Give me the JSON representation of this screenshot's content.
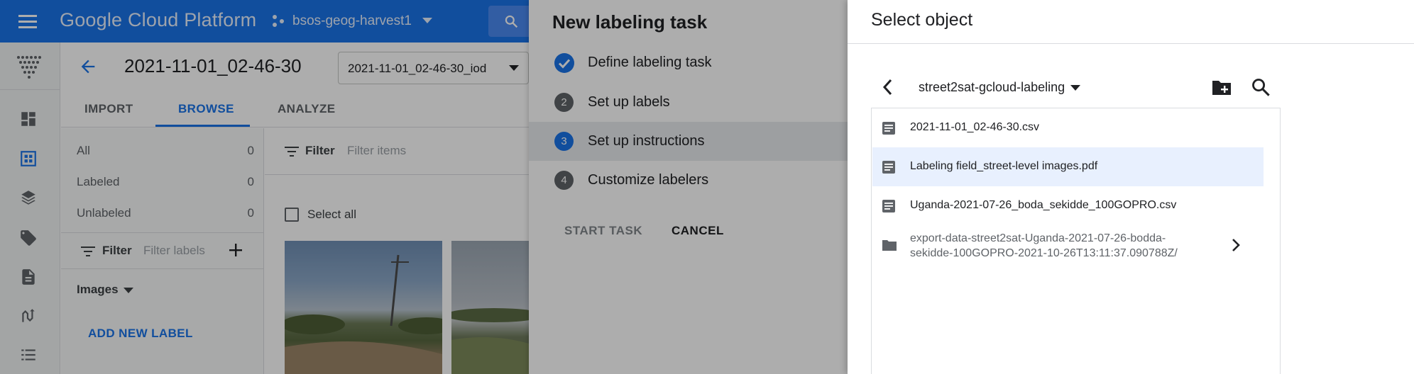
{
  "topbar": {
    "brand": "Google Cloud Platform",
    "project": "bsos-geog-harvest1"
  },
  "dataset": {
    "title": "2021-11-01_02-46-30",
    "selected_version": "2021-11-01_02-46-30_iod"
  },
  "tabs": [
    {
      "label": "IMPORT"
    },
    {
      "label": "BROWSE"
    },
    {
      "label": "ANALYZE"
    }
  ],
  "filter_panel": {
    "counts": [
      {
        "label": "All",
        "count": "0"
      },
      {
        "label": "Labeled",
        "count": "0"
      },
      {
        "label": "Unlabeled",
        "count": "0"
      }
    ],
    "filter_label": "Filter",
    "filter_placeholder": "Filter labels",
    "images_label": "Images",
    "add_label": "ADD NEW LABEL"
  },
  "items": {
    "filter_label": "Filter",
    "filter_placeholder": "Filter items",
    "select_all": "Select all"
  },
  "task_panel": {
    "title": "New labeling task",
    "steps": [
      {
        "num": "1",
        "label": "Define labeling task",
        "state": "done"
      },
      {
        "num": "2",
        "label": "Set up labels",
        "state": "pending"
      },
      {
        "num": "3",
        "label": "Set up instructions",
        "state": "active"
      },
      {
        "num": "4",
        "label": "Customize labelers",
        "state": "pending"
      }
    ],
    "start_label": "START TASK",
    "cancel_label": "CANCEL"
  },
  "select_panel": {
    "title": "Select object",
    "bucket": "street2sat-gcloud-labeling",
    "files": [
      {
        "name": "2021-11-01_02-46-30.csv",
        "type": "file"
      },
      {
        "name": "Labeling field_street-level images.pdf",
        "type": "file",
        "selected": true
      },
      {
        "name": "Uganda-2021-07-26_boda_sekidde_100GOPRO.csv",
        "type": "file"
      },
      {
        "name_line1": "export-data-street2sat-Uganda-2021-07-26-bodda-",
        "name_line2": "sekidde-100GOPRO-2021-10-26T13:11:37.090788Z/",
        "type": "folder"
      }
    ]
  },
  "colors": {
    "primary": "#1a73e8",
    "topbar": "#1a73e8",
    "selected_row": "#e8f0fe",
    "active_step_bg": "#e8eaed"
  }
}
